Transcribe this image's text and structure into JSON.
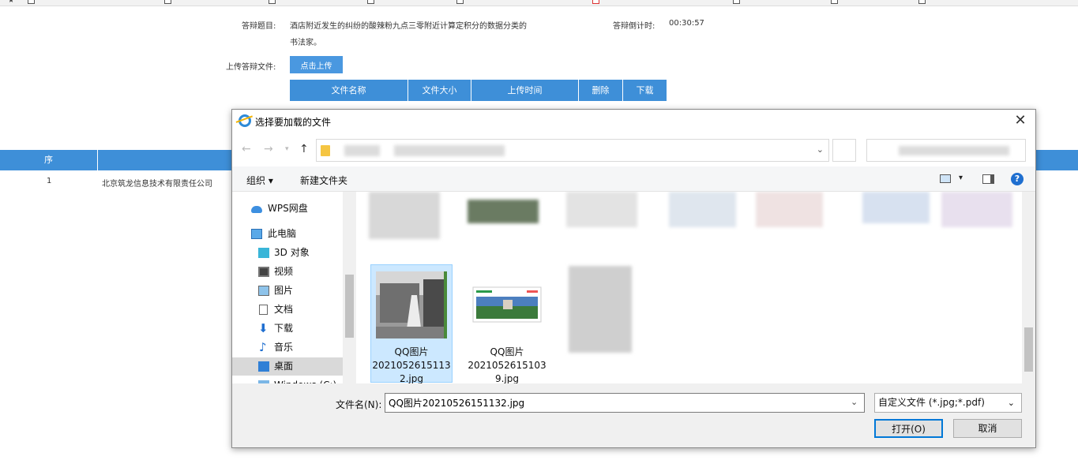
{
  "bookmarks": [
    "",
    "",
    "",
    "",
    "",
    "",
    "",
    "",
    "",
    "",
    ""
  ],
  "answer": {
    "topic_label": "答辩题目:",
    "topic_text_line1": "酒店附近发生的纠纷的酸辣粉九点三零附近计算定积分的数据分类的",
    "topic_text_line2": "书法家。",
    "countdown_label": "答辩倒计时:",
    "countdown_value": "00:30:57",
    "upload_label": "上传答辩文件:",
    "upload_button": "点击上传",
    "table_headers": [
      "文件名称",
      "文件大小",
      "上传时间",
      "删除",
      "下载"
    ]
  },
  "list": {
    "header_seq": "序",
    "rows": [
      {
        "seq": "1",
        "company": "北京筑龙信息技术有限责任公司"
      }
    ]
  },
  "dialog": {
    "title": "选择要加载的文件",
    "close_glyph": "✕",
    "toolbar": {
      "organize": "组织 ▾",
      "new_folder": "新建文件夹",
      "help": "?"
    },
    "sidebar": [
      {
        "label": "WPS网盘",
        "icon": "cloud-icon"
      },
      {
        "label": "此电脑",
        "icon": "computer-icon"
      },
      {
        "label": "3D 对象",
        "icon": "cube-icon"
      },
      {
        "label": "视频",
        "icon": "film-icon"
      },
      {
        "label": "图片",
        "icon": "picture-icon"
      },
      {
        "label": "文档",
        "icon": "document-icon"
      },
      {
        "label": "下载",
        "icon": "download-icon"
      },
      {
        "label": "音乐",
        "icon": "music-icon"
      },
      {
        "label": "桌面",
        "icon": "desktop-icon"
      },
      {
        "label": "Windows (C:)",
        "icon": "drive-icon"
      }
    ],
    "files": [
      {
        "name_line1": "QQ图片",
        "name_line2": "2021052615113",
        "name_line3": "2.jpg",
        "selected": true
      },
      {
        "name_line1": "QQ图片",
        "name_line2": "2021052615103",
        "name_line3": "9.jpg",
        "selected": false
      }
    ],
    "filename_label": "文件名(N):",
    "filename_value": "QQ图片20210526151132.jpg",
    "filetype_value": "自定义文件 (*.jpg;*.pdf)",
    "open_button": "打开(O)",
    "cancel_button": "取消"
  },
  "colors": {
    "accent": "#3e8fd8",
    "selection": "#cce8ff"
  }
}
